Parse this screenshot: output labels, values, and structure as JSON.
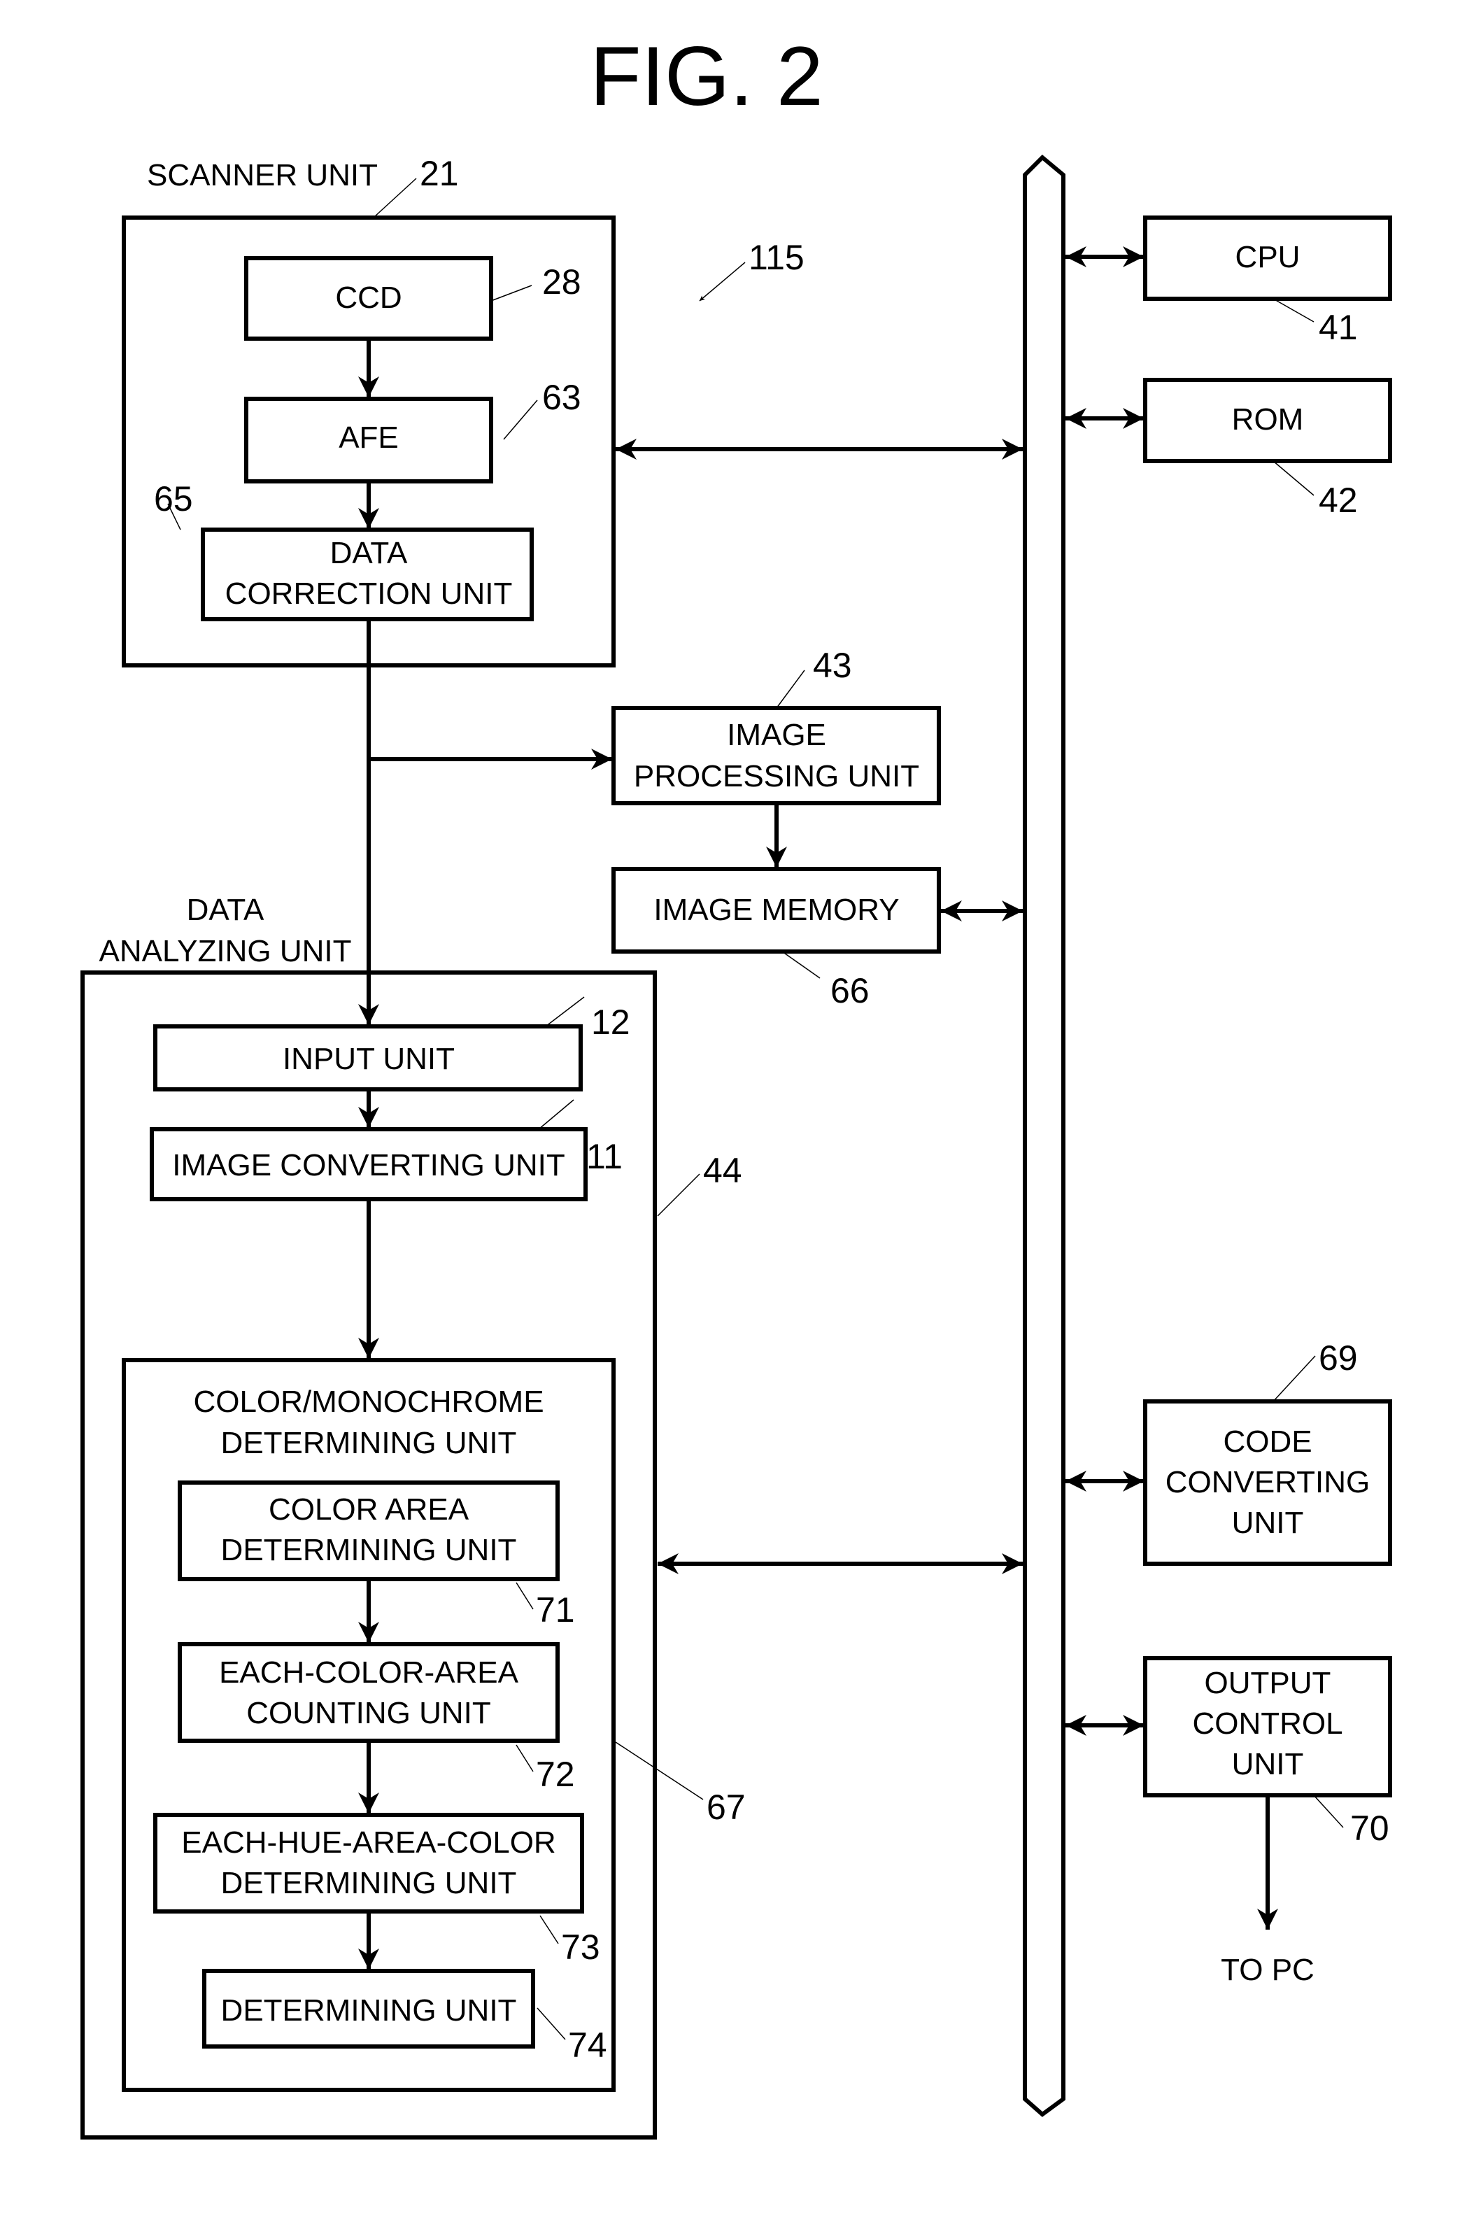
{
  "figure_title": "FIG. 2",
  "device_ref": "115",
  "colors": {
    "stroke": "#000000",
    "background": "#ffffff"
  },
  "scanner_unit": {
    "label": "SCANNER UNIT",
    "ref": "21",
    "blocks": {
      "ccd": {
        "lines": [
          "CCD"
        ],
        "ref": "28"
      },
      "afe": {
        "lines": [
          "AFE"
        ],
        "ref": "63"
      },
      "data_correction": {
        "lines": [
          "DATA",
          "CORRECTION UNIT"
        ],
        "ref": "65"
      }
    }
  },
  "image_processing": {
    "lines": [
      "IMAGE",
      "PROCESSING UNIT"
    ],
    "ref": "43"
  },
  "image_memory": {
    "lines": [
      "IMAGE MEMORY"
    ],
    "ref": "66"
  },
  "data_analyzing_unit": {
    "label_lines": [
      "DATA",
      "ANALYZING UNIT"
    ],
    "ref": "44",
    "input_unit": {
      "lines": [
        "INPUT UNIT"
      ],
      "ref": "12"
    },
    "image_converting": {
      "lines": [
        "IMAGE CONVERTING UNIT"
      ],
      "ref": "11"
    },
    "color_mono": {
      "label_lines": [
        "COLOR/MONOCHROME",
        "DETERMINING UNIT"
      ],
      "ref": "67",
      "color_area": {
        "lines": [
          "COLOR AREA",
          "DETERMINING UNIT"
        ],
        "ref": "71"
      },
      "each_color_area": {
        "lines": [
          "EACH-COLOR-AREA",
          "COUNTING UNIT"
        ],
        "ref": "72"
      },
      "each_hue_area": {
        "lines": [
          "EACH-HUE-AREA-COLOR",
          "DETERMINING UNIT"
        ],
        "ref": "73"
      },
      "determining": {
        "lines": [
          "DETERMINING UNIT"
        ],
        "ref": "74"
      }
    }
  },
  "cpu": {
    "lines": [
      "CPU"
    ],
    "ref": "41"
  },
  "rom": {
    "lines": [
      "ROM"
    ],
    "ref": "42"
  },
  "code_converting": {
    "lines": [
      "CODE",
      "CONVERTING",
      "UNIT"
    ],
    "ref": "69"
  },
  "output_control": {
    "lines": [
      "OUTPUT",
      "CONTROL",
      "UNIT"
    ],
    "ref": "70"
  },
  "to_pc": "TO PC"
}
